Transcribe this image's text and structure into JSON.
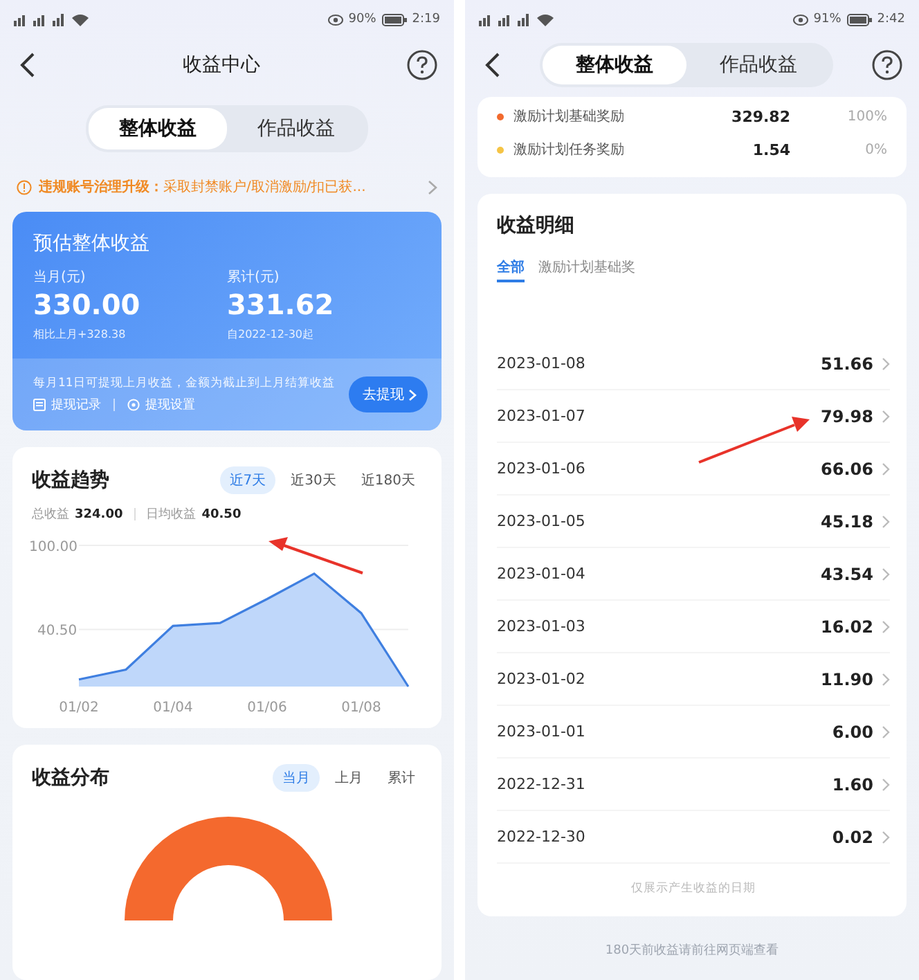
{
  "left_screen": {
    "status_bar": {
      "battery": "90%",
      "time": "2:19"
    },
    "header": {
      "title": "收益中心"
    },
    "tabs": [
      {
        "label": "整体收益",
        "selected": true
      },
      {
        "label": "作品收益",
        "selected": false
      }
    ],
    "notice": {
      "text": "**违规账号治理升级：**采取封禁账户/取消激励/扣已获..."
    },
    "estimate_card": {
      "title": "预估整体收益",
      "stats": [
        {
          "label": "当月(元)",
          "value": "330.00",
          "note": "相比上月+328.38"
        },
        {
          "label": "累计(元)",
          "value": "331.62",
          "note": "自2022-12-30起"
        }
      ],
      "withdraw_note": "每月11日可提现上月收益，金额为截止到上月结算收益",
      "links": [
        "提现记录",
        "提现设置"
      ],
      "button": "去提现"
    },
    "trend": {
      "title": "收益趋势",
      "ranges": [
        {
          "label": "近7天",
          "selected": true
        },
        {
          "label": "近30天",
          "selected": false
        },
        {
          "label": "近180天",
          "selected": false
        }
      ],
      "summary": [
        {
          "label": "总收益",
          "value": "324.00"
        },
        {
          "label": "日均收益",
          "value": "40.50"
        }
      ],
      "chart_data": {
        "type": "area",
        "categories": [
          "01/02",
          null,
          "01/04",
          null,
          "01/06",
          null,
          "01/08",
          null
        ],
        "series": [
          {
            "color": "#3f7fe0",
            "values": [
              5,
              12,
              43,
              45,
              62,
              80,
              52,
              0
            ]
          }
        ],
        "ylim": [
          0,
          100
        ],
        "yticks": [
          {
            "value": 40.5,
            "label": "40.50"
          },
          {
            "value": 100,
            "label": "100.00"
          }
        ]
      }
    },
    "distribution": {
      "title": "收益分布",
      "periods": [
        {
          "label": "当月",
          "selected": true
        },
        {
          "label": "上月",
          "selected": false
        },
        {
          "label": "累计",
          "selected": false
        }
      ]
    }
  },
  "right_screen": {
    "status_bar": {
      "battery": "91%",
      "time": "2:42"
    },
    "tabs": [
      {
        "label": "整体收益",
        "selected": true
      },
      {
        "label": "作品收益",
        "selected": false
      }
    ],
    "legend": [
      {
        "name": "激励计划基础奖励",
        "amount": "329.82",
        "percent": "100%",
        "color": "#f26a2e"
      },
      {
        "name": "激励计划任务奖励",
        "amount": "1.54",
        "percent": "0%",
        "color": "#f5c445"
      }
    ],
    "details": {
      "title": "收益明细",
      "filters": [
        {
          "label": "全部",
          "selected": true
        },
        {
          "label": "激励计划基础奖",
          "selected": false
        }
      ],
      "rows": [
        {
          "date": "2023-01-08",
          "amount": "51.66"
        },
        {
          "date": "2023-01-07",
          "amount": "79.98"
        },
        {
          "date": "2023-01-06",
          "amount": "66.06"
        },
        {
          "date": "2023-01-05",
          "amount": "45.18"
        },
        {
          "date": "2023-01-04",
          "amount": "43.54"
        },
        {
          "date": "2023-01-03",
          "amount": "16.02"
        },
        {
          "date": "2023-01-02",
          "amount": "11.90"
        },
        {
          "date": "2023-01-01",
          "amount": "6.00"
        },
        {
          "date": "2022-12-31",
          "amount": "1.60"
        },
        {
          "date": "2022-12-30",
          "amount": "0.02"
        }
      ],
      "footnote": "仅展示产生收益的日期"
    },
    "bottom_note": "180天前收益请前往网页端查看"
  }
}
